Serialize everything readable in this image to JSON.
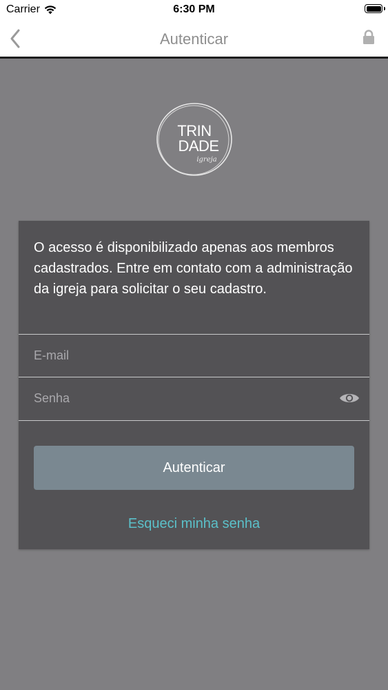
{
  "status_bar": {
    "carrier": "Carrier",
    "time": "6:30 PM"
  },
  "nav": {
    "title": "Autenticar",
    "back_icon": "chevron-left-icon",
    "lock_icon": "lock-icon"
  },
  "logo": {
    "line1": "TRIN",
    "line2": "DADE",
    "script": "igreja"
  },
  "card": {
    "message": "O acesso é disponibilizado apenas aos membros cadastrados. Entre em contato com a administração da igreja para solicitar o seu cadastro.",
    "email_placeholder": "E-mail",
    "email_value": "",
    "password_placeholder": "Senha",
    "password_value": "",
    "submit_label": "Autenticar",
    "forgot_label": "Esqueci minha senha"
  },
  "colors": {
    "background": "#807f82",
    "card": "#535255",
    "button": "#7a8891",
    "link": "#5bc0c9"
  }
}
